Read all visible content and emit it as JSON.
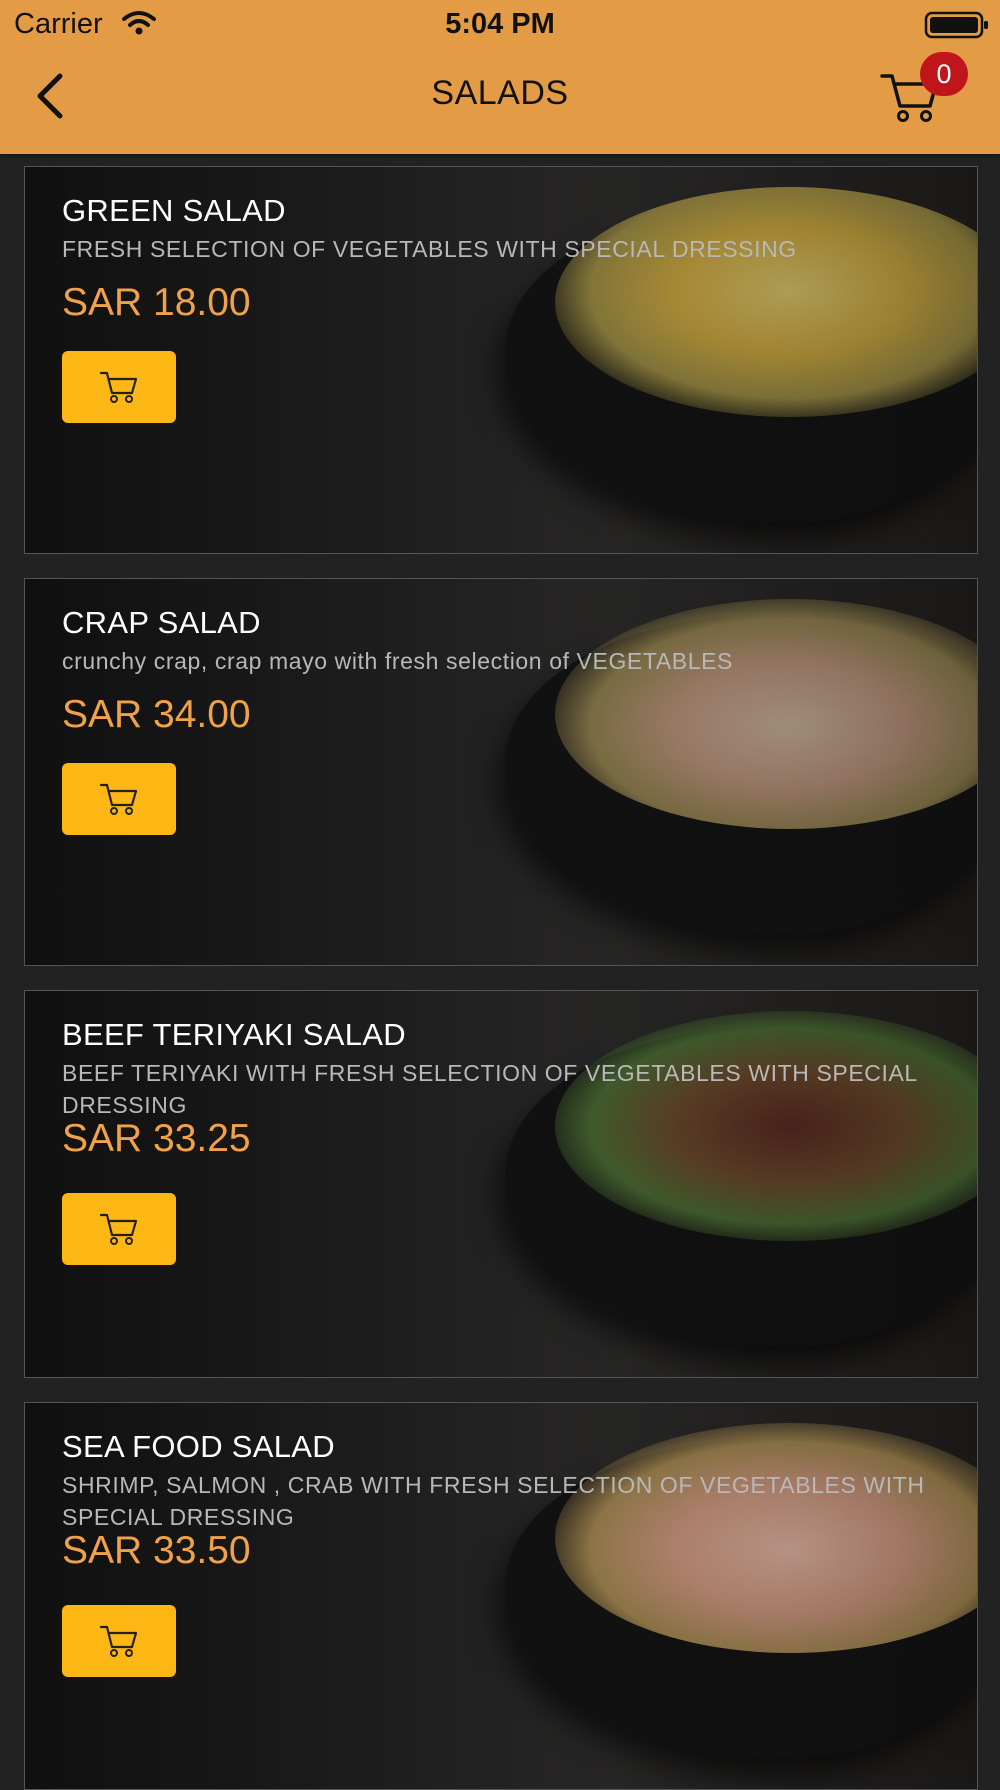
{
  "status_bar": {
    "carrier": "Carrier",
    "time": "5:04 PM"
  },
  "nav": {
    "title": "SALADS",
    "cart_count": "0"
  },
  "items": [
    {
      "name": "GREEN SALAD",
      "description": "FRESH SELECTION OF VEGETABLES WITH SPECIAL DRESSING",
      "price": "SAR 18.00"
    },
    {
      "name": "CRAP SALAD",
      "description": "crunchy crap, crap mayo with fresh selection of VEGETABLES",
      "price": "SAR 34.00"
    },
    {
      "name": "BEEF TERIYAKI SALAD",
      "description": "BEEF TERIYAKI WITH FRESH SELECTION OF VEGETABLES WITH SPECIAL DRESSING",
      "price": "SAR 33.25"
    },
    {
      "name": "SEA FOOD SALAD",
      "description": "SHRIMP, SALMON , CRAB WITH FRESH SELECTION OF VEGETABLES WITH SPECIAL DRESSING",
      "price": "SAR 33.50"
    }
  ],
  "colors": {
    "header": "#E39C45",
    "accent_button": "#FDB714",
    "price": "#F0A24A",
    "badge": "#C0151B"
  },
  "icons": {
    "back": "chevron-left-icon",
    "cart": "cart-icon",
    "add_to_cart": "cart-icon"
  }
}
